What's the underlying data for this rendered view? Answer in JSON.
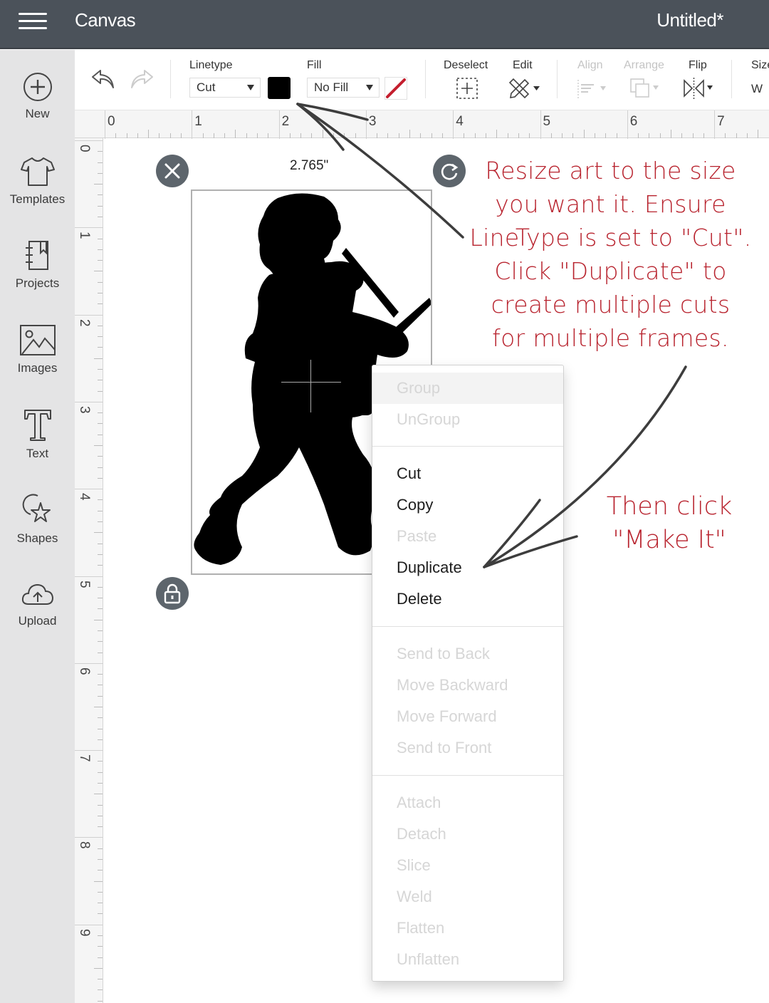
{
  "header": {
    "menu_icon": "hamburger-icon",
    "app_title": "Canvas",
    "document_title": "Untitled*"
  },
  "sidebar": {
    "items": [
      {
        "label": "New",
        "icon": "plus-circle-icon"
      },
      {
        "label": "Templates",
        "icon": "tshirt-icon"
      },
      {
        "label": "Projects",
        "icon": "notebook-icon"
      },
      {
        "label": "Images",
        "icon": "image-icon"
      },
      {
        "label": "Text",
        "icon": "text-t-icon"
      },
      {
        "label": "Shapes",
        "icon": "shapes-icon"
      },
      {
        "label": "Upload",
        "icon": "cloud-upload-icon"
      }
    ]
  },
  "toolbar": {
    "undo_icon": "undo-icon",
    "redo_icon": "redo-icon",
    "linetype_label": "Linetype",
    "linetype_value": "Cut",
    "linetype_color": "#000000",
    "fill_label": "Fill",
    "fill_value": "No Fill",
    "fill_color_icon": "no-fill-slash-icon",
    "deselect_label": "Deselect",
    "edit_label": "Edit",
    "align_label": "Align",
    "arrange_label": "Arrange",
    "flip_label": "Flip",
    "size_label": "Size",
    "size_w_label": "W"
  },
  "rulers": {
    "horizontal": [
      "0",
      "1",
      "2",
      "3",
      "4",
      "5",
      "6",
      "7"
    ],
    "vertical": [
      "0",
      "1",
      "2",
      "3",
      "4",
      "5",
      "6",
      "7",
      "8",
      "9"
    ]
  },
  "selection": {
    "width_label": "2.765\"",
    "image": "drummer-boy-silhouette",
    "handles": {
      "delete": "close-x-icon",
      "rotate": "rotate-icon",
      "lock": "lock-icon"
    }
  },
  "context_menu": {
    "groups": [
      [
        {
          "label": "Group",
          "enabled": false
        },
        {
          "label": "UnGroup",
          "enabled": false
        }
      ],
      [
        {
          "label": "Cut",
          "enabled": true
        },
        {
          "label": "Copy",
          "enabled": true
        },
        {
          "label": "Paste",
          "enabled": false
        },
        {
          "label": "Duplicate",
          "enabled": true
        },
        {
          "label": "Delete",
          "enabled": true
        }
      ],
      [
        {
          "label": "Send to Back",
          "enabled": false
        },
        {
          "label": "Move Backward",
          "enabled": false
        },
        {
          "label": "Move Forward",
          "enabled": false
        },
        {
          "label": "Send to Front",
          "enabled": false
        }
      ],
      [
        {
          "label": "Attach",
          "enabled": false
        },
        {
          "label": "Detach",
          "enabled": false
        },
        {
          "label": "Slice",
          "enabled": false
        },
        {
          "label": "Weld",
          "enabled": false
        },
        {
          "label": "Flatten",
          "enabled": false
        },
        {
          "label": "Unflatten",
          "enabled": false
        }
      ]
    ]
  },
  "annotations": {
    "instruction_1": [
      "Resize art to the size",
      "you want it. Ensure",
      "LineType is set to \"Cut\".",
      "Click \"Duplicate\" to",
      "create multiple cuts",
      "for multiple frames."
    ],
    "instruction_2": [
      "Then click",
      "\"Make It\""
    ],
    "color": "#b8232e"
  }
}
